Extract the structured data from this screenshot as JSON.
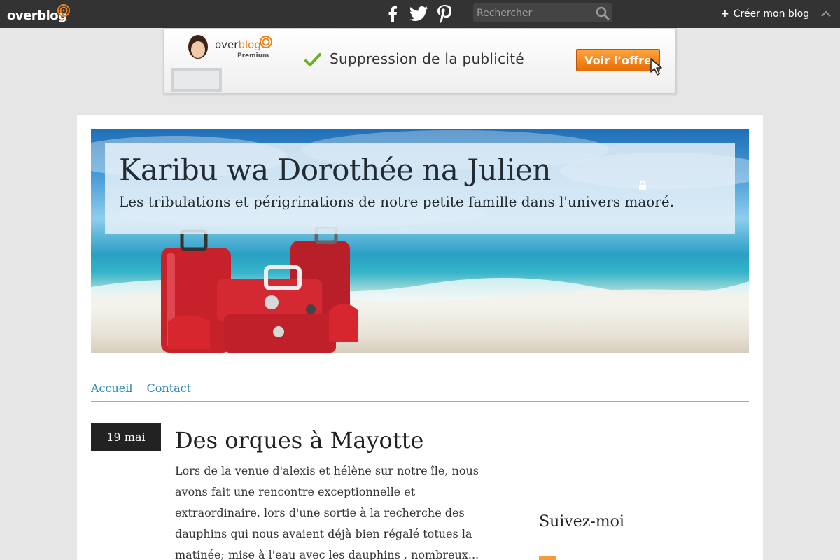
{
  "topbar": {
    "logo_prefix": "over",
    "logo_suffix": "blog",
    "search_placeholder": "Rechercher",
    "create_blog_label": "Créer mon blog",
    "colors": {
      "bar": "#333333",
      "accent": "#e8821e"
    }
  },
  "ad": {
    "brand_prefix": "over",
    "brand_suffix": "blog",
    "brand_tier": "Premium",
    "message": "Suppression de la publicité",
    "cta_label": "Voir l’offre"
  },
  "header": {
    "title": "Karibu wa Dorothée na Julien",
    "subtitle": "Les tribulations et périgrinations de notre petite famille dans l'univers maoré."
  },
  "nav": {
    "items": [
      {
        "label": "Accueil"
      },
      {
        "label": "Contact"
      }
    ],
    "link_color": "#2a8ab8"
  },
  "post": {
    "date": "19 mai",
    "title": "Des orques à Mayotte",
    "excerpt": "Lors de la venue d'alexis et hélène sur notre île, nous avons fait une rencontre exceptionnelle et extraordinaire. lors d'une sortie à la recherche des dauphins qui nous avaient déjà bien régalé totues la matinée; mise à l'eau avec les dauphins , nombreux..."
  },
  "sidebar": {
    "follow_title": "Suivez-moi"
  }
}
